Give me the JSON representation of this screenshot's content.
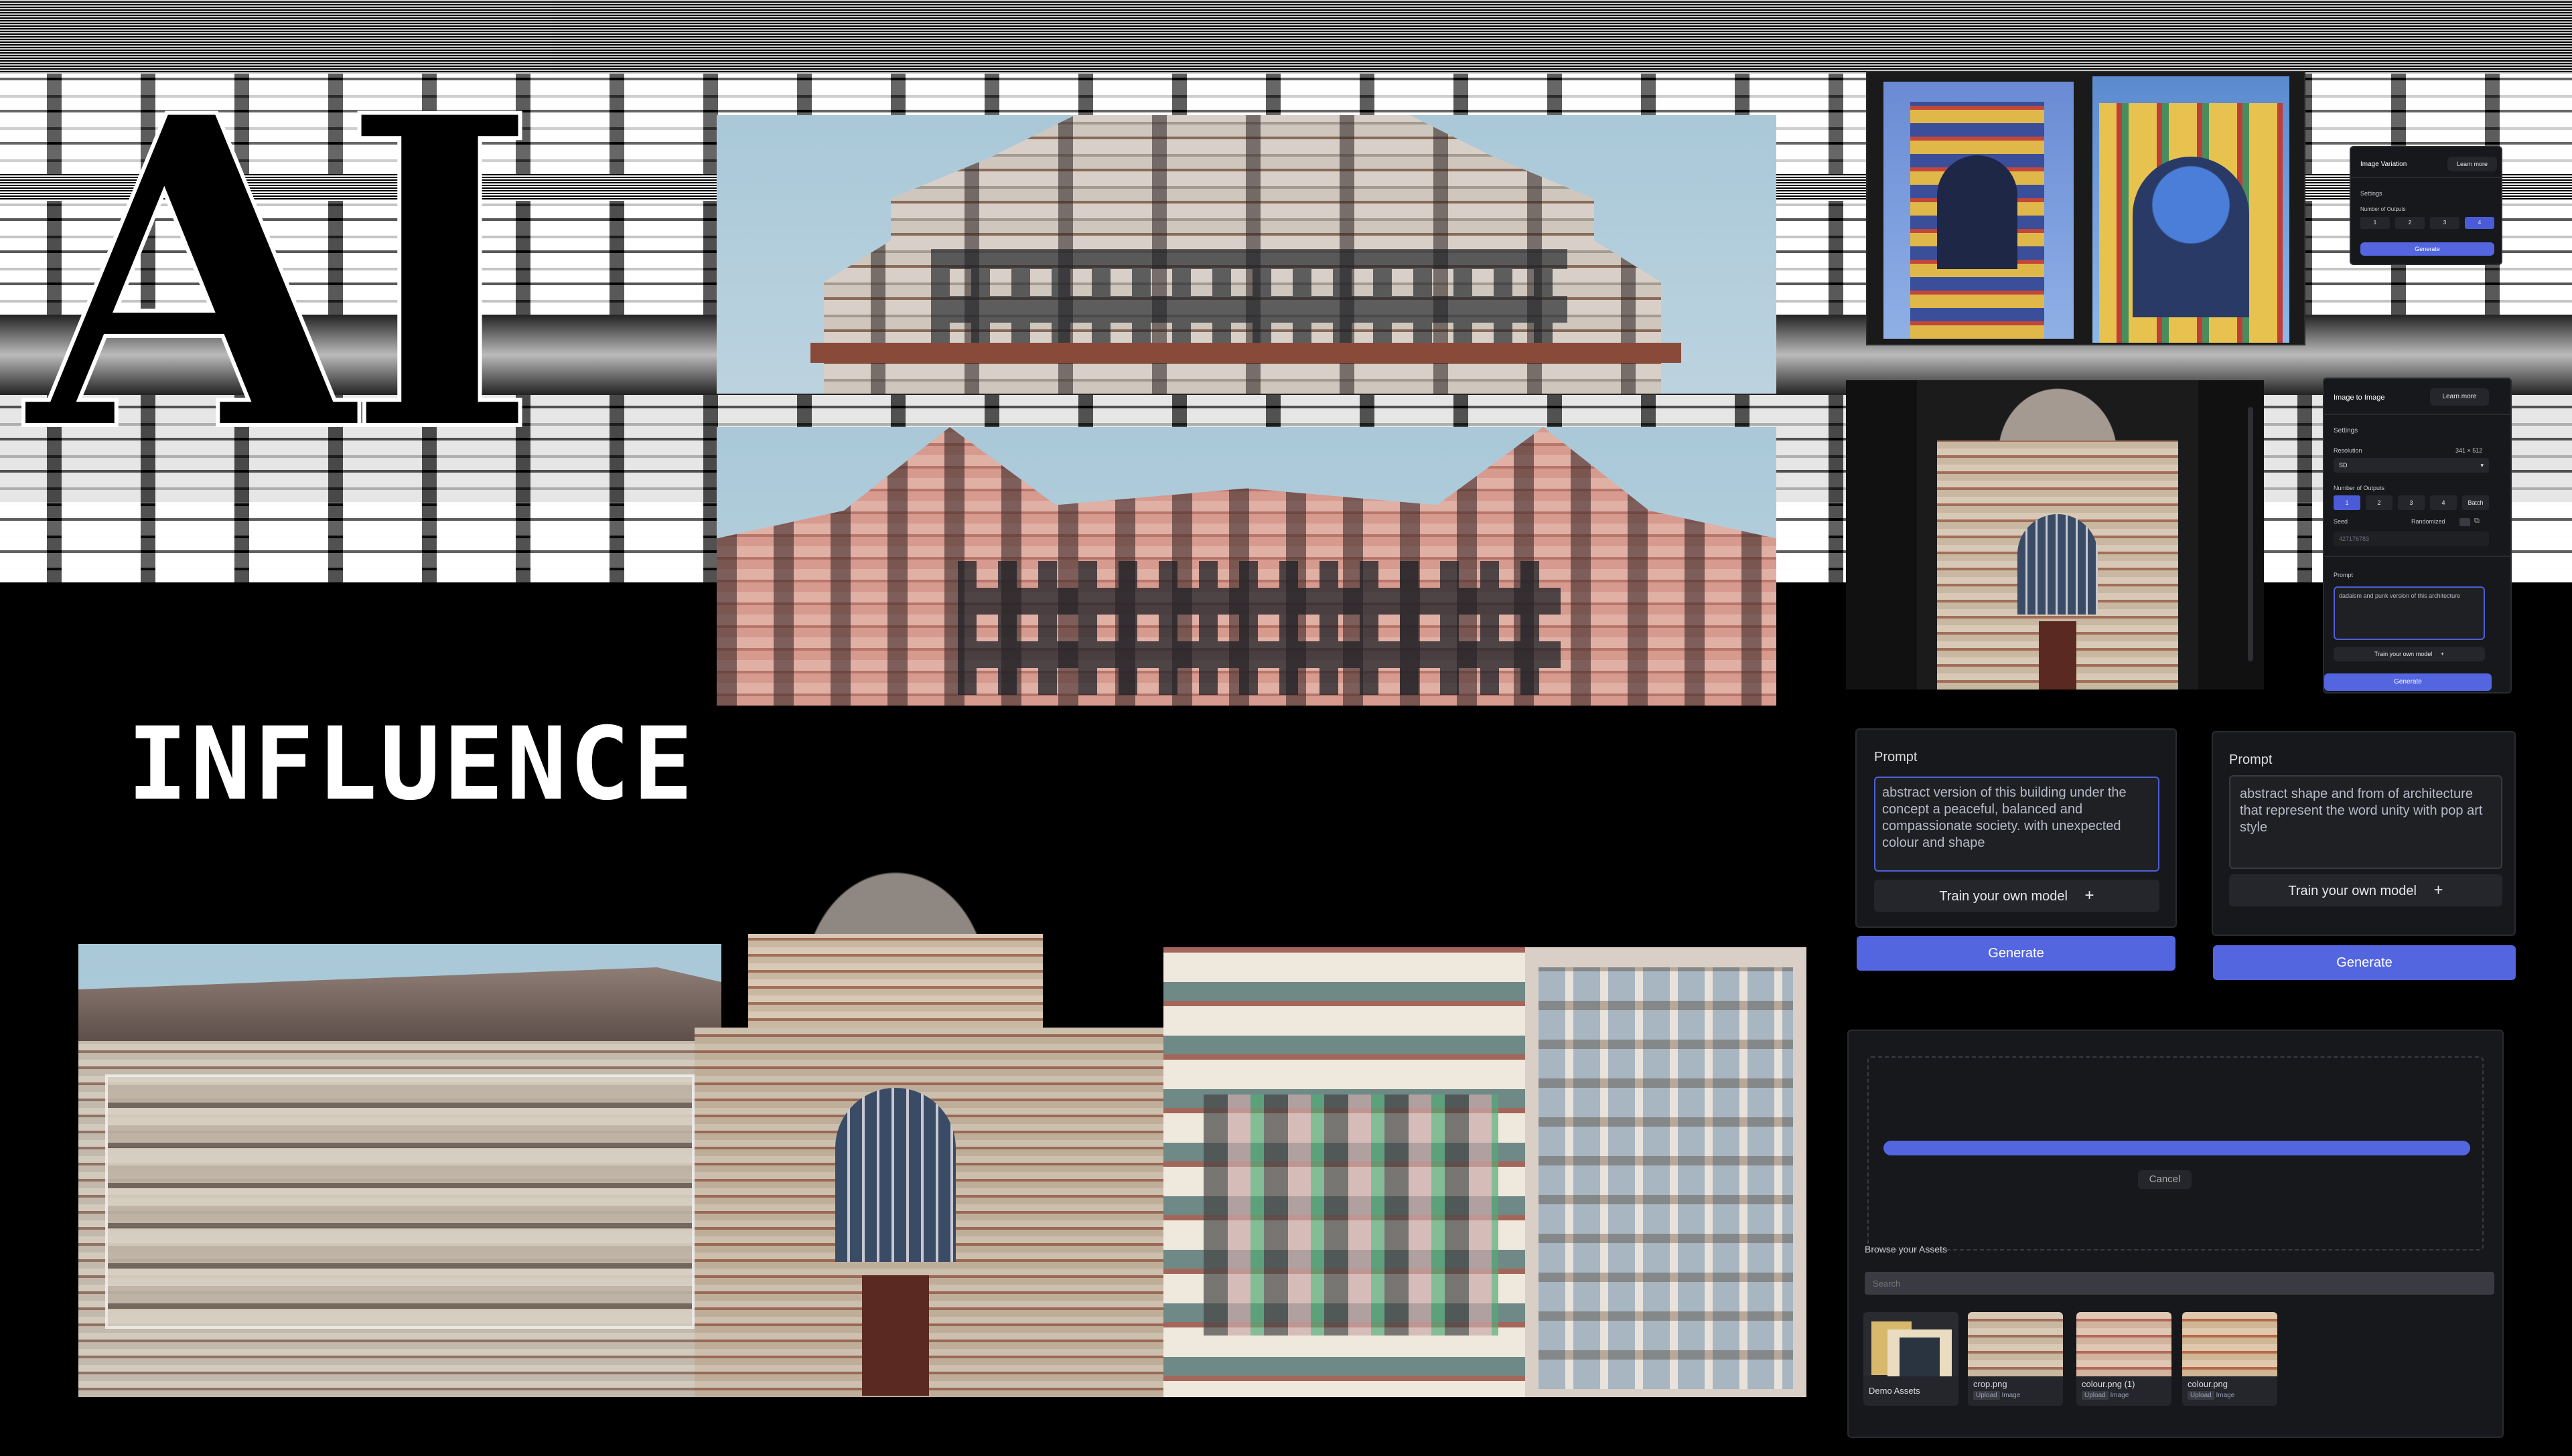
{
  "poster": {
    "letters": "AI",
    "subtitle": "INFLUENCE"
  },
  "image_variation": {
    "title": "Image Variation",
    "learn_more": "Learn more",
    "settings_label": "Settings",
    "outputs_label": "Number of Outputs",
    "output_options": [
      "1",
      "2",
      "3",
      "4"
    ],
    "selected_output": "4",
    "generate": "Generate"
  },
  "image_to_image": {
    "title": "Image to Image",
    "learn_more": "Learn more",
    "settings_label": "Settings",
    "resolution_label": "Resolution",
    "resolution_value": "341 × 512",
    "model_value": "SD",
    "outputs_label": "Number of Outputs",
    "output_options": [
      "1",
      "2",
      "3",
      "4",
      "Batch"
    ],
    "seed_label": "Seed",
    "seed_mode": "Randomized",
    "seed_value": "427176783",
    "prompt_label": "Prompt",
    "prompt_text": "dadaism and punk version of this architecture",
    "train_label": "Train your own model",
    "generate": "Generate"
  },
  "prompt_panel_1": {
    "label": "Prompt",
    "text": "abstract version of this building under the concept a peaceful, balanced and compassionate society. with unexpected colour and shape",
    "train_label": "Train your own model",
    "generate": "Generate"
  },
  "prompt_panel_2": {
    "label": "Prompt",
    "text": "abstract shape and from of architecture that represent the word unity with pop art style",
    "train_label": "Train your own model",
    "generate": "Generate"
  },
  "upload_panel": {
    "cancel": "Cancel",
    "browse_label": "Browse your Assets",
    "search_placeholder": "Search",
    "assets": [
      {
        "name": "Demo Assets",
        "tag": ""
      },
      {
        "name": "crop.png",
        "tag": "Upload",
        "type": "Image"
      },
      {
        "name": "colour.png (1)",
        "tag": "Upload",
        "type": "Image"
      },
      {
        "name": "colour.png",
        "tag": "Upload",
        "type": "Image"
      }
    ]
  },
  "colors": {
    "accent": "#5366e0",
    "panel_bg": "#17181b",
    "background": "#000000"
  }
}
